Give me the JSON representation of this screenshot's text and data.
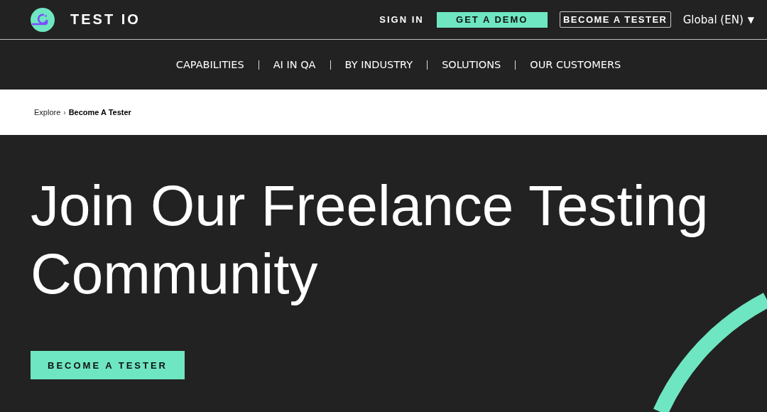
{
  "header": {
    "brand": "TEST IO",
    "sign_in": "SIGN IN",
    "demo_button": "GET A DEMO",
    "tester_button": "BECOME A TESTER",
    "language": "Global (EN)",
    "language_caret": "▼"
  },
  "nav": [
    {
      "label": "CAPABILITIES"
    },
    {
      "label": "AI IN QA"
    },
    {
      "label": "BY INDUSTRY"
    },
    {
      "label": "SOLUTIONS"
    },
    {
      "label": "OUR CUSTOMERS"
    }
  ],
  "breadcrumb": {
    "items": [
      {
        "label": "Explore",
        "current": false
      },
      {
        "label": "Become A Tester",
        "current": true
      }
    ],
    "separator": "›"
  },
  "hero": {
    "title": "Join Our Freelance Testing Community",
    "button": "BECOME A TESTER"
  }
}
